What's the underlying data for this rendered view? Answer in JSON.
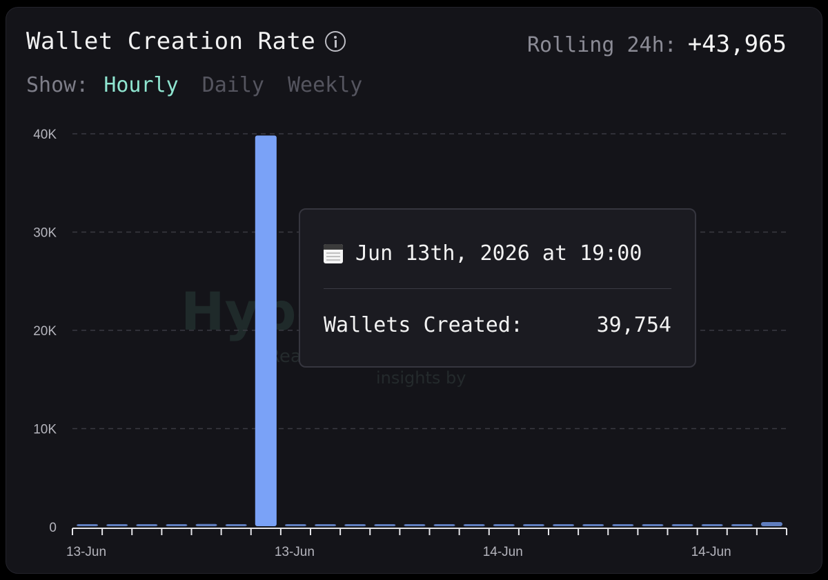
{
  "header": {
    "title": "Wallet Creation Rate",
    "rolling_label": "Rolling 24h:",
    "rolling_value": "+43,965"
  },
  "show": {
    "label": "Show:",
    "options": [
      "Hourly",
      "Daily",
      "Weekly"
    ],
    "active": "Hourly"
  },
  "watermark": {
    "brand": "Hype",
    "line1": "Rea",
    "line2": "insights by"
  },
  "tooltip": {
    "date": "Jun 13th, 2026 at 19:00",
    "metric_label": "Wallets Created:",
    "metric_value": "39,754"
  },
  "colors": {
    "bar": "#7aa2f7",
    "accent": "#8fe5d0",
    "grid": "#3a3a42",
    "axis_text": "#b5b5bd"
  },
  "chart_data": {
    "type": "bar",
    "x_tick_labels": [
      "13-Jun",
      "13-Jun",
      "14-Jun",
      "14-Jun"
    ],
    "x_tick_label_at_index": [
      0,
      7,
      14,
      21
    ],
    "y_ticks": [
      0,
      10000,
      20000,
      30000,
      40000
    ],
    "y_tick_labels": [
      "0",
      "10K",
      "20K",
      "30K",
      "40K"
    ],
    "ylim": [
      0,
      40000
    ],
    "grid": "horizontal-dashed",
    "values": [
      180,
      200,
      150,
      210,
      230,
      160,
      39754,
      140,
      130,
      150,
      170,
      140,
      130,
      150,
      160,
      140,
      180,
      170,
      150,
      190,
      160,
      140,
      200,
      420
    ],
    "highlight_index": 6
  }
}
